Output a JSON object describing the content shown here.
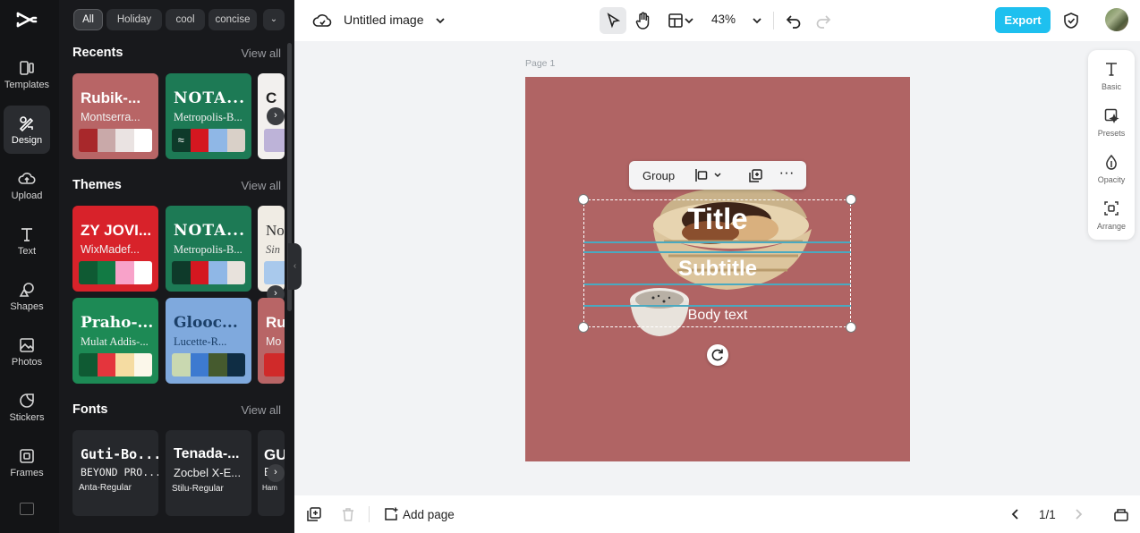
{
  "rail": {
    "items": [
      {
        "label": "Templates"
      },
      {
        "label": "Design"
      },
      {
        "label": "Upload"
      },
      {
        "label": "Text"
      },
      {
        "label": "Shapes"
      },
      {
        "label": "Photos"
      },
      {
        "label": "Stickers"
      },
      {
        "label": "Frames"
      }
    ]
  },
  "panel": {
    "chips": [
      "All",
      "Holiday",
      "cool",
      "concise"
    ],
    "sections": {
      "recents": {
        "title": "Recents",
        "view_all": "View all"
      },
      "themes": {
        "title": "Themes",
        "view_all": "View all"
      },
      "fonts": {
        "title": "Fonts",
        "view_all": "View all"
      }
    },
    "recents": [
      {
        "t1": "Rubik-...",
        "t2": "Montserra...",
        "bg": "#b86566",
        "swatches": [
          "#a8282b",
          "#c9a9a9",
          "#eae3e2",
          "#ffffff"
        ]
      },
      {
        "t1": "NOTA...",
        "t2": "Metropolis-B...",
        "bg": "#1d7a55",
        "swatches": [
          "#0e3a2a",
          "#d41720",
          "#8fb7e6",
          "#d9d0c8"
        ]
      },
      {
        "t1": "C",
        "t2": "",
        "bg": "#f2f0ee",
        "swatches": [
          "#bdb3d8"
        ]
      }
    ],
    "themes": [
      {
        "t1": "ZY JOVI...",
        "t2": "WixMadef...",
        "bg": "#d8222a",
        "swatches": [
          "#0f5a33",
          "#127a44",
          "#f8a2c9",
          "#ffffff"
        ]
      },
      {
        "t1": "NOTA...",
        "t2": "Metropolis-B...",
        "bg": "#1d7a55",
        "swatches": [
          "#0e3a2a",
          "#d41720",
          "#8fb7e6",
          "#e8e2dc"
        ]
      },
      {
        "t1": "No",
        "t2": "Sin",
        "bg": "#f0ece4",
        "swatches": [
          "#a9c9ec"
        ]
      },
      {
        "t1": "Praho-...",
        "t2": "Mulat Addis-...",
        "bg": "#1d8a55",
        "swatches": [
          "#0f5a33",
          "#e4353d",
          "#f5dca2",
          "#fbf7ea"
        ]
      },
      {
        "t1": "Glooc...",
        "t2": "Lucette-R...",
        "bg": "#7fa9dd",
        "swatches": [
          "#c9d8b0",
          "#3d7ad0",
          "#455a2e",
          "#0f2d44"
        ]
      },
      {
        "t1": "Ru",
        "t2": "Mo",
        "bg": "#b86566",
        "swatches": [
          "#d02a2a"
        ]
      }
    ],
    "fonts": [
      {
        "t1": "Guti-Bo...",
        "t2": "BEYOND PRO...",
        "t3": "Anta-Regular"
      },
      {
        "t1": "Tenada-...",
        "t2": "Zocbel X-E...",
        "t3": "Stilu-Regular"
      },
      {
        "t1": "GU",
        "t2": "B",
        "t3": "Ham"
      }
    ]
  },
  "topbar": {
    "title": "Untitled image",
    "zoom": "43%",
    "export": "Export"
  },
  "canvas": {
    "page_label": "Page 1",
    "bg": "#b06464",
    "title": "Title",
    "subtitle": "Subtitle",
    "body": "Body text",
    "context_menu": {
      "group": "Group"
    }
  },
  "right_tools": [
    {
      "label": "Basic"
    },
    {
      "label": "Presets"
    },
    {
      "label": "Opacity"
    },
    {
      "label": "Arrange"
    }
  ],
  "bottombar": {
    "add_page": "Add page",
    "page_count": "1/1"
  }
}
